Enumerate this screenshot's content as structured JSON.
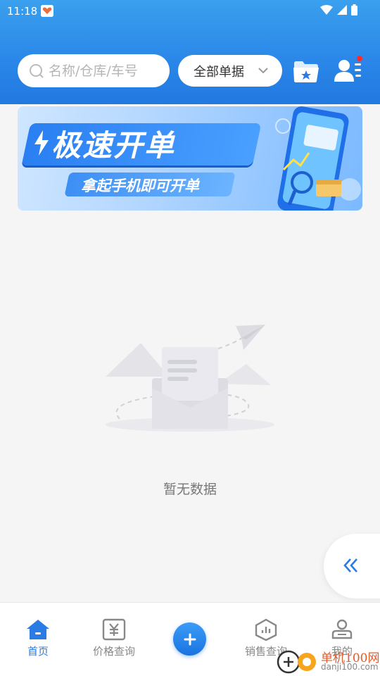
{
  "status_bar": {
    "time": "11:18"
  },
  "search": {
    "placeholder": "名称/仓库/车号"
  },
  "filter": {
    "selected": "全部单据"
  },
  "banner": {
    "title": "极速开单",
    "subtitle": "拿起手机即可开单"
  },
  "empty_state": {
    "message": "暂无数据"
  },
  "bottom_nav": {
    "items": [
      {
        "label": "首页",
        "icon": "home-icon",
        "active": true
      },
      {
        "label": "价格查询",
        "icon": "yuan-icon",
        "active": false
      },
      {
        "label": "",
        "icon": "plus-icon",
        "active": false
      },
      {
        "label": "销售查询",
        "icon": "chart-icon",
        "active": false
      },
      {
        "label": "我的",
        "icon": "profile-icon",
        "active": false
      }
    ]
  },
  "watermark": {
    "text": "单机100网",
    "sub": "danji100.com"
  },
  "colors": {
    "primary": "#2b7be4",
    "header_top": "#3aa0ee",
    "header_bottom": "#2279e0",
    "badge": "#ff2a2a"
  }
}
